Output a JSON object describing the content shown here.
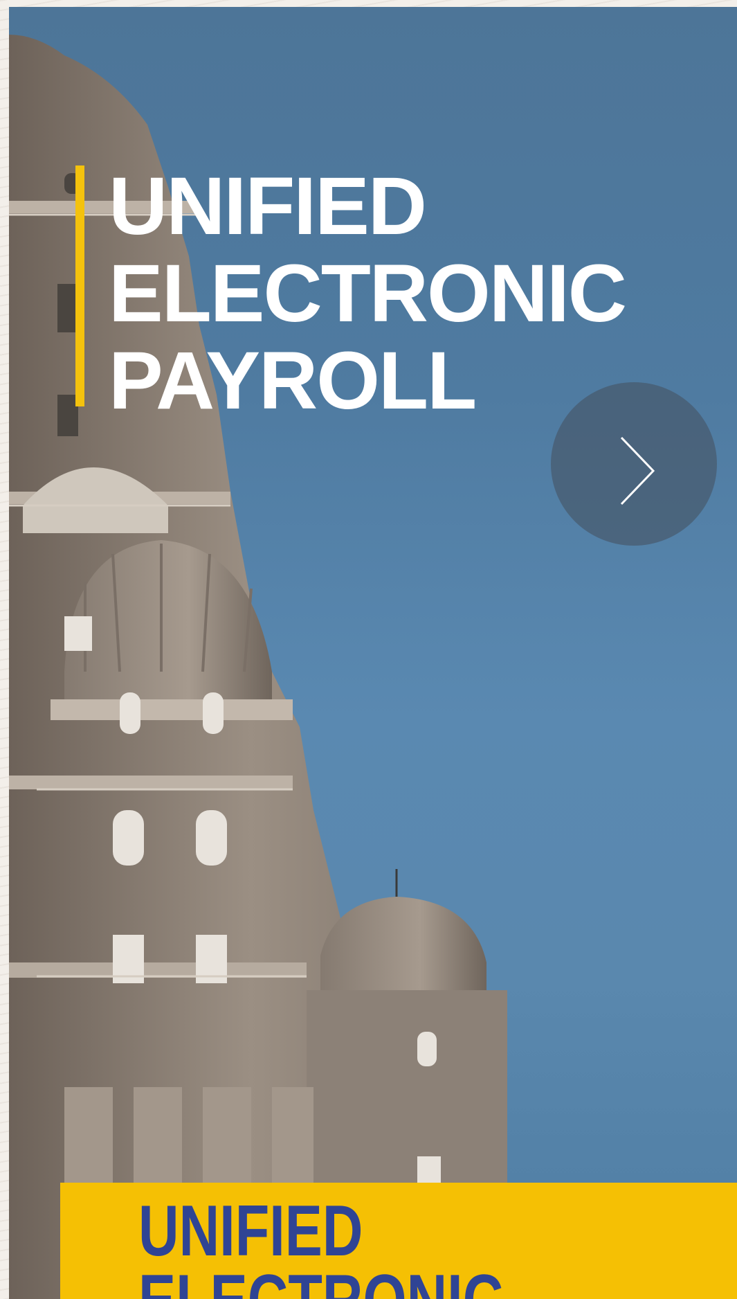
{
  "hero": {
    "title_lines": [
      "UNIFIED",
      "ELECTRONIC",
      "PAYROLL"
    ],
    "accent_color": "#f4c20d",
    "next_button_icon": "chevron-right-icon"
  },
  "panel": {
    "title_lines": [
      "UNIFIED",
      "ELECTRONIC"
    ],
    "background_color": "#f5c004",
    "text_color": "#2f4494"
  }
}
